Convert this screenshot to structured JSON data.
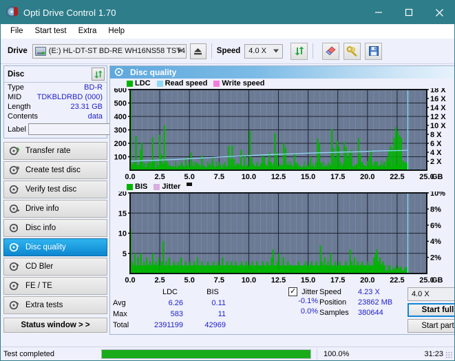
{
  "window": {
    "title": "Opti Drive Control 1.70",
    "icon": "disc-icon",
    "minimize": "–",
    "maximize": "□",
    "close": "✕"
  },
  "menu": {
    "items": [
      "File",
      "Start test",
      "Extra",
      "Help"
    ]
  },
  "toolbar": {
    "drive_label": "Drive",
    "drive_value": "(E:)  HL-DT-ST BD-RE  WH16NS58 TST4",
    "eject_icon": "eject-icon",
    "speed_label": "Speed",
    "speed_value": "4.0 X",
    "refresh_icon": "refresh-icon",
    "eraser_icon": "eraser-icon",
    "tools_icon": "tools-icon",
    "save_icon": "save-icon"
  },
  "sidebar": {
    "disc_panel": {
      "title": "Disc",
      "refresh_icon": "refresh-icon",
      "rows": [
        {
          "key": "Type",
          "value": "BD-R"
        },
        {
          "key": "MID",
          "value": "TDKBLDRBD (000)"
        },
        {
          "key": "Length",
          "value": "23.31 GB"
        },
        {
          "key": "Contents",
          "value": "data"
        }
      ],
      "label_key": "Label",
      "label_value": "",
      "label_placeholder": "",
      "label_button_icon": "disc-icon"
    },
    "nav_items": [
      {
        "label": "Transfer rate",
        "icon": "disc-transfer-icon",
        "active": false
      },
      {
        "label": "Create test disc",
        "icon": "disc-create-icon",
        "active": false
      },
      {
        "label": "Verify test disc",
        "icon": "disc-verify-icon",
        "active": false
      },
      {
        "label": "Drive info",
        "icon": "disc-drive-icon",
        "active": false
      },
      {
        "label": "Disc info",
        "icon": "disc-info-icon",
        "active": false
      },
      {
        "label": "Disc quality",
        "icon": "disc-quality-icon",
        "active": true
      },
      {
        "label": "CD Bler",
        "icon": "disc-bler-icon",
        "active": false
      },
      {
        "label": "FE / TE",
        "icon": "disc-fete-icon",
        "active": false
      },
      {
        "label": "Extra tests",
        "icon": "disc-extra-icon",
        "active": false
      }
    ],
    "status_window_button": "Status window > >"
  },
  "main": {
    "header_title": "Disc quality",
    "header_icon": "disc-quality-icon"
  },
  "chart_data": [
    {
      "type": "bar",
      "id": "ldc-chart",
      "title": "LDC",
      "xlabel": "GB",
      "ylabel": "LDC",
      "legend": [
        {
          "name": "LDC",
          "color": "#00b400"
        },
        {
          "name": "Read speed",
          "color": "#8fd8f5"
        },
        {
          "name": "Write speed",
          "color": "#f47ce0"
        }
      ],
      "legend_position": "top-left",
      "grid": true,
      "plot_bg": "#6b7a95",
      "xlim": [
        0,
        25
      ],
      "xticks": [
        0.0,
        2.5,
        5.0,
        7.5,
        10.0,
        12.5,
        15.0,
        17.5,
        20.0,
        22.5,
        25.0
      ],
      "xtick_labels": [
        "0.0",
        "2.5",
        "5.0",
        "7.5",
        "10.0",
        "12.5",
        "15.0",
        "17.5",
        "20.0",
        "22.5",
        "25.0"
      ],
      "x_unit": "GB",
      "ylim": [
        0,
        600
      ],
      "yticks": [
        100,
        200,
        300,
        400,
        500,
        600
      ],
      "ytick_labels": [
        "100",
        "200",
        "300",
        "400",
        "500",
        "600"
      ],
      "y2lim": [
        0,
        18
      ],
      "y2ticks": [
        2,
        4,
        6,
        8,
        10,
        12,
        14,
        16,
        18
      ],
      "y2tick_labels": [
        "2 X",
        "4 X",
        "6 X",
        "8 X",
        "10 X",
        "12 X",
        "14 X",
        "16 X",
        "18 X"
      ],
      "data_end_x": 23.4,
      "series": [
        {
          "name": "LDC",
          "color": "#00b400",
          "x": [
            0.05,
            0.2,
            0.35,
            0.5,
            0.62,
            0.75,
            0.88,
            1.0,
            1.15,
            1.3,
            1.45,
            1.6,
            1.75,
            1.9,
            2.05,
            2.2,
            2.35,
            2.5,
            2.62,
            2.75,
            2.9,
            3.05,
            3.2,
            3.35,
            3.5,
            3.65,
            3.8,
            3.95,
            4.1,
            4.25,
            4.4,
            4.55,
            4.7,
            4.85,
            5.0,
            5.15,
            5.3,
            5.45,
            5.6,
            5.75,
            5.9,
            6.05,
            6.2,
            6.35,
            6.5,
            6.65,
            6.8,
            6.95,
            7.1,
            7.25,
            7.4,
            7.55,
            7.7,
            7.85,
            8.0,
            8.15,
            8.3,
            8.45,
            8.6,
            8.75,
            8.9,
            9.05,
            9.2,
            9.35,
            9.5,
            9.65,
            9.8,
            9.95,
            10.1,
            10.25,
            10.4,
            10.55,
            10.7,
            10.85,
            11.0,
            11.15,
            11.3,
            11.45,
            11.6,
            11.75,
            11.9,
            12.05,
            12.2,
            12.35,
            12.5,
            12.65,
            12.8,
            12.95,
            13.1,
            13.25,
            13.4,
            13.55,
            13.7,
            13.85,
            14.0,
            14.15,
            14.3,
            14.45,
            14.6,
            14.75,
            14.9,
            15.05,
            15.2,
            15.35,
            15.5,
            15.65,
            15.8,
            15.95,
            16.1,
            16.25,
            16.4,
            16.55,
            16.7,
            16.85,
            17.0,
            17.15,
            17.3,
            17.45,
            17.6,
            17.75,
            17.9,
            18.05,
            18.2,
            18.35,
            18.5,
            18.65,
            18.8,
            18.95,
            19.1,
            19.25,
            19.4,
            19.55,
            19.7,
            19.85,
            20.0,
            20.15,
            20.3,
            20.45,
            20.6,
            20.75,
            20.9,
            21.05,
            21.2,
            21.35,
            21.5,
            21.65,
            21.8,
            21.95,
            22.1,
            22.25,
            22.4,
            22.55,
            22.7,
            22.85,
            23.0,
            23.15,
            23.3
          ],
          "values": [
            590,
            40,
            30,
            255,
            35,
            25,
            150,
            205,
            20,
            15,
            30,
            20,
            18,
            245,
            80,
            20,
            35,
            265,
            120,
            40,
            335,
            70,
            30,
            25,
            20,
            18,
            22,
            16,
            20,
            14,
            18,
            12,
            95,
            20,
            18,
            130,
            20,
            16,
            18,
            14,
            20,
            110,
            16,
            12,
            20,
            14,
            18,
            90,
            12,
            14,
            18,
            60,
            12,
            16,
            20,
            14,
            180,
            85,
            185,
            80,
            30,
            45,
            35,
            150,
            30,
            115,
            25,
            30,
            295,
            90,
            35,
            28,
            24,
            30,
            26,
            115,
            95,
            40,
            30,
            130,
            60,
            22,
            275,
            130,
            30,
            26,
            35,
            200,
            165,
            40,
            30,
            24,
            22,
            120,
            30,
            26,
            24,
            20,
            22,
            18,
            20,
            24,
            100,
            16,
            22,
            18,
            235,
            200,
            55,
            30,
            26,
            22,
            20,
            24,
            305,
            165,
            95,
            220,
            175,
            60,
            30,
            210,
            170,
            100,
            130,
            150,
            25,
            40,
            30,
            240,
            120,
            60,
            35,
            30,
            32,
            100,
            150,
            35,
            28,
            25,
            30,
            26,
            24,
            30,
            28,
            90,
            150,
            185,
            160,
            240,
            320,
            290,
            260,
            240,
            70,
            60,
            55,
            40,
            30
          ]
        },
        {
          "name": "Read speed",
          "color": "#8fd8f5",
          "x": [
            0.0,
            1.0,
            2.0,
            3.0,
            4.0,
            5.0,
            6.0,
            7.0,
            8.0,
            9.0,
            10.0,
            11.0,
            12.0,
            13.0,
            14.0,
            15.0,
            16.0,
            17.0,
            18.0,
            19.0,
            20.0,
            21.0,
            22.0,
            23.0,
            23.4
          ],
          "values_x": [
            2.0,
            2.1,
            2.2,
            2.3,
            2.4,
            2.55,
            2.7,
            2.85,
            3.0,
            3.1,
            3.25,
            3.4,
            3.5,
            3.6,
            3.7,
            3.8,
            3.9,
            3.95,
            4.05,
            4.1,
            4.2,
            4.3,
            4.35,
            4.4,
            4.45
          ]
        },
        {
          "name": "Write speed",
          "color": "#f47ce0",
          "x": [],
          "values": []
        }
      ]
    },
    {
      "type": "bar",
      "id": "bis-chart",
      "title": "BIS",
      "xlabel": "GB",
      "ylabel": "BIS",
      "legend": [
        {
          "name": "BIS",
          "color": "#00b400"
        },
        {
          "name": "Jitter",
          "color": "#d9aee0"
        }
      ],
      "legend_position": "top-left",
      "grid": true,
      "plot_bg": "#6b7a95",
      "xlim": [
        0,
        25
      ],
      "xticks": [
        0.0,
        2.5,
        5.0,
        7.5,
        10.0,
        12.5,
        15.0,
        17.5,
        20.0,
        22.5,
        25.0
      ],
      "xtick_labels": [
        "0.0",
        "2.5",
        "5.0",
        "7.5",
        "10.0",
        "12.5",
        "15.0",
        "17.5",
        "20.0",
        "22.5",
        "25.0"
      ],
      "x_unit": "GB",
      "ylim": [
        0,
        20
      ],
      "yticks": [
        5,
        10,
        15,
        20
      ],
      "ytick_labels": [
        "5",
        "10",
        "15",
        "20"
      ],
      "y2lim": [
        0,
        10
      ],
      "y2ticks": [
        2,
        4,
        6,
        8,
        10
      ],
      "y2tick_labels": [
        "2%",
        "4%",
        "6%",
        "8%",
        "10%"
      ],
      "data_end_x": 23.4,
      "series": [
        {
          "name": "BIS",
          "color": "#00b400",
          "x": [
            0.05,
            0.18,
            0.3,
            0.42,
            0.55,
            0.68,
            0.8,
            0.92,
            1.05,
            1.18,
            1.3,
            1.42,
            1.55,
            1.68,
            1.8,
            1.92,
            2.05,
            2.18,
            2.3,
            2.42,
            2.55,
            2.68,
            2.8,
            2.92,
            3.05,
            3.18,
            3.3,
            3.42,
            3.55,
            3.68,
            3.8,
            3.92,
            4.05,
            4.18,
            4.3,
            4.42,
            4.55,
            4.68,
            4.8,
            4.92,
            5.05,
            5.18,
            5.3,
            5.42,
            5.55,
            5.68,
            5.8,
            5.92,
            6.05,
            6.18,
            6.3,
            6.42,
            6.55,
            6.68,
            6.8,
            6.92,
            7.05,
            7.18,
            7.3,
            7.42,
            7.55,
            7.68,
            7.8,
            7.92,
            8.05,
            8.18,
            8.3,
            8.42,
            8.55,
            8.68,
            8.8,
            8.92,
            9.05,
            9.18,
            9.3,
            9.42,
            9.55,
            9.68,
            9.8,
            9.92,
            10.05,
            10.18,
            10.3,
            10.42,
            10.55,
            10.68,
            10.8,
            10.92,
            11.05,
            11.18,
            11.3,
            11.42,
            11.55,
            11.68,
            11.8,
            11.92,
            12.05,
            12.18,
            12.3,
            12.42,
            12.55,
            12.68,
            12.8,
            12.92,
            13.05,
            13.18,
            13.3,
            13.42,
            13.55,
            13.68,
            13.8,
            13.92,
            14.05,
            14.18,
            14.3,
            14.42,
            14.55,
            14.68,
            14.8,
            14.92,
            15.05,
            15.18,
            15.3,
            15.42,
            15.55,
            15.68,
            15.8,
            15.92,
            16.05,
            16.18,
            16.3,
            16.42,
            16.55,
            16.68,
            16.8,
            16.92,
            17.05,
            17.18,
            17.3,
            17.42,
            17.55,
            17.68,
            17.8,
            17.92,
            18.05,
            18.18,
            18.3,
            18.42,
            18.55,
            18.68,
            18.8,
            18.92,
            19.05,
            19.18,
            19.3,
            19.42,
            19.55,
            19.68,
            19.8,
            19.92,
            20.05,
            20.18,
            20.3,
            20.42,
            20.55,
            20.68,
            20.8,
            20.92,
            21.05,
            21.18,
            21.3,
            21.42,
            21.55,
            21.68,
            21.8,
            21.92,
            22.05,
            22.18,
            22.3,
            22.42,
            22.55,
            22.68,
            22.8,
            22.92,
            23.05,
            23.18,
            23.3
          ],
          "values": [
            11,
            3,
            2,
            5,
            2,
            4,
            2,
            5,
            2,
            3,
            2,
            4,
            2,
            3,
            2,
            5,
            2,
            3,
            2,
            4,
            2,
            3,
            8,
            2,
            3,
            2,
            4,
            2,
            2,
            3,
            2,
            2,
            3,
            2,
            4,
            2,
            2,
            3,
            2,
            2,
            3,
            2,
            2,
            3,
            2,
            4,
            2,
            2,
            3,
            2,
            2,
            2,
            3,
            2,
            2,
            2,
            3,
            2,
            2,
            3,
            2,
            2,
            4,
            2,
            2,
            3,
            2,
            2,
            3,
            2,
            2,
            3,
            2,
            2,
            2,
            3,
            2,
            2,
            3,
            2,
            2,
            2,
            3,
            2,
            2,
            3,
            2,
            2,
            2,
            3,
            2,
            2,
            3,
            2,
            2,
            4,
            6,
            2,
            2,
            3,
            5,
            2,
            2,
            4,
            2,
            2,
            3,
            2,
            2,
            2,
            2,
            2,
            2,
            3,
            2,
            2,
            2,
            2,
            3,
            2,
            2,
            2,
            3,
            2,
            2,
            3,
            2,
            2,
            7,
            3,
            2,
            4,
            2,
            3,
            2,
            5,
            2,
            2,
            3,
            2,
            2,
            3,
            2,
            2,
            2,
            3,
            2,
            2,
            6,
            3,
            2,
            4,
            2,
            3,
            2,
            2,
            3,
            2,
            2,
            2,
            3,
            2,
            2,
            2,
            4,
            5,
            6,
            3,
            4,
            2,
            3,
            2
          ]
        },
        {
          "name": "Jitter",
          "color": "#d9aee0",
          "x": [],
          "values": []
        }
      ]
    }
  ],
  "stats": {
    "col_headers": [
      "",
      "LDC",
      "BIS"
    ],
    "rows": [
      {
        "key": "Avg",
        "ldc": "6.26",
        "bis": "0.11"
      },
      {
        "key": "Max",
        "ldc": "583",
        "bis": "11"
      },
      {
        "key": "Total",
        "ldc": "2391199",
        "bis": "42969"
      }
    ],
    "jitter": {
      "checkbox_label": "Jitter",
      "checked": true,
      "check_glyph": "✓",
      "avg": "-0.1%",
      "max": "0.0%"
    },
    "speed": {
      "key": "Speed",
      "value": "4.23 X"
    },
    "position": {
      "key": "Position",
      "value": "23862 MB"
    },
    "samples": {
      "key": "Samples",
      "value": "380644"
    },
    "speed_select": "4.0 X",
    "start_full": "Start full",
    "start_part": "Start part"
  },
  "statusbar": {
    "text": "Test completed",
    "progress_percent": "100.0%",
    "progress_value": 100,
    "elapsed": "31:23"
  },
  "colors": {
    "titlebar": "#2e7d8a",
    "window_bg": "#eef0fb",
    "accent_blue": "#1084d6",
    "value_blue": "#2020cc",
    "chart_green": "#00b400",
    "chart_plot_bg": "#6b7a95",
    "read_speed": "#8fd8f5",
    "write_speed": "#f47ce0",
    "jitter": "#d9aee0",
    "progress_green": "#1aab1a"
  }
}
